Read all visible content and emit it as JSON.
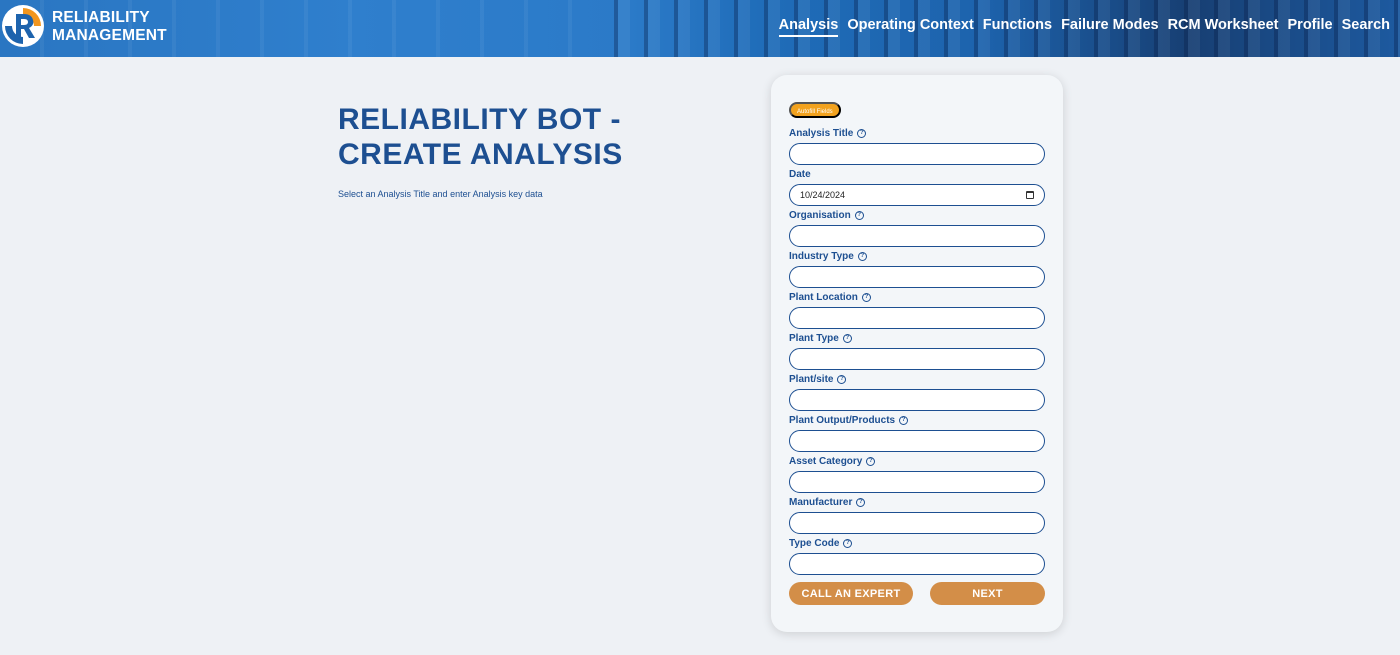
{
  "brand": {
    "line1": "RELIABILITY",
    "line2": "MANAGEMENT",
    "logo_icon": "rm-logo-icon",
    "colors": {
      "orange": "#f2961e",
      "blue": "#1d63ad"
    }
  },
  "nav": [
    {
      "label": "Analysis",
      "active": true
    },
    {
      "label": "Operating Context",
      "active": false
    },
    {
      "label": "Functions",
      "active": false
    },
    {
      "label": "Failure Modes",
      "active": false
    },
    {
      "label": "RCM Worksheet",
      "active": false
    },
    {
      "label": "Profile",
      "active": false
    },
    {
      "label": "Search",
      "active": false
    }
  ],
  "hero": {
    "title": "RELIABILITY BOT - CREATE ANALYSIS",
    "subtitle": "Select an Analysis Title and enter Analysis key data"
  },
  "form": {
    "autofill_label": "Autofill Fields",
    "fields": [
      {
        "label": "Analysis Title",
        "value": "",
        "help_icon": true
      },
      {
        "label": "Date",
        "value": "10/24/2024",
        "help_icon": false,
        "type": "date"
      },
      {
        "label": "Organisation",
        "value": "",
        "help_icon": true
      },
      {
        "label": "Industry Type",
        "value": "",
        "help_icon": true
      },
      {
        "label": "Plant Location",
        "value": "",
        "help_icon": true
      },
      {
        "label": "Plant Type",
        "value": "",
        "help_icon": true
      },
      {
        "label": "Plant/site",
        "value": "",
        "help_icon": true
      },
      {
        "label": "Plant Output/Products",
        "value": "",
        "help_icon": true
      },
      {
        "label": "Asset Category",
        "value": "",
        "help_icon": true
      },
      {
        "label": "Manufacturer",
        "value": "",
        "help_icon": true
      },
      {
        "label": "Type Code",
        "value": "",
        "help_icon": true
      }
    ],
    "call_expert_label": "CALL AN EXPERT",
    "next_label": "NEXT",
    "button_color": "#d38e48",
    "accent_color": "#f2a21e"
  }
}
